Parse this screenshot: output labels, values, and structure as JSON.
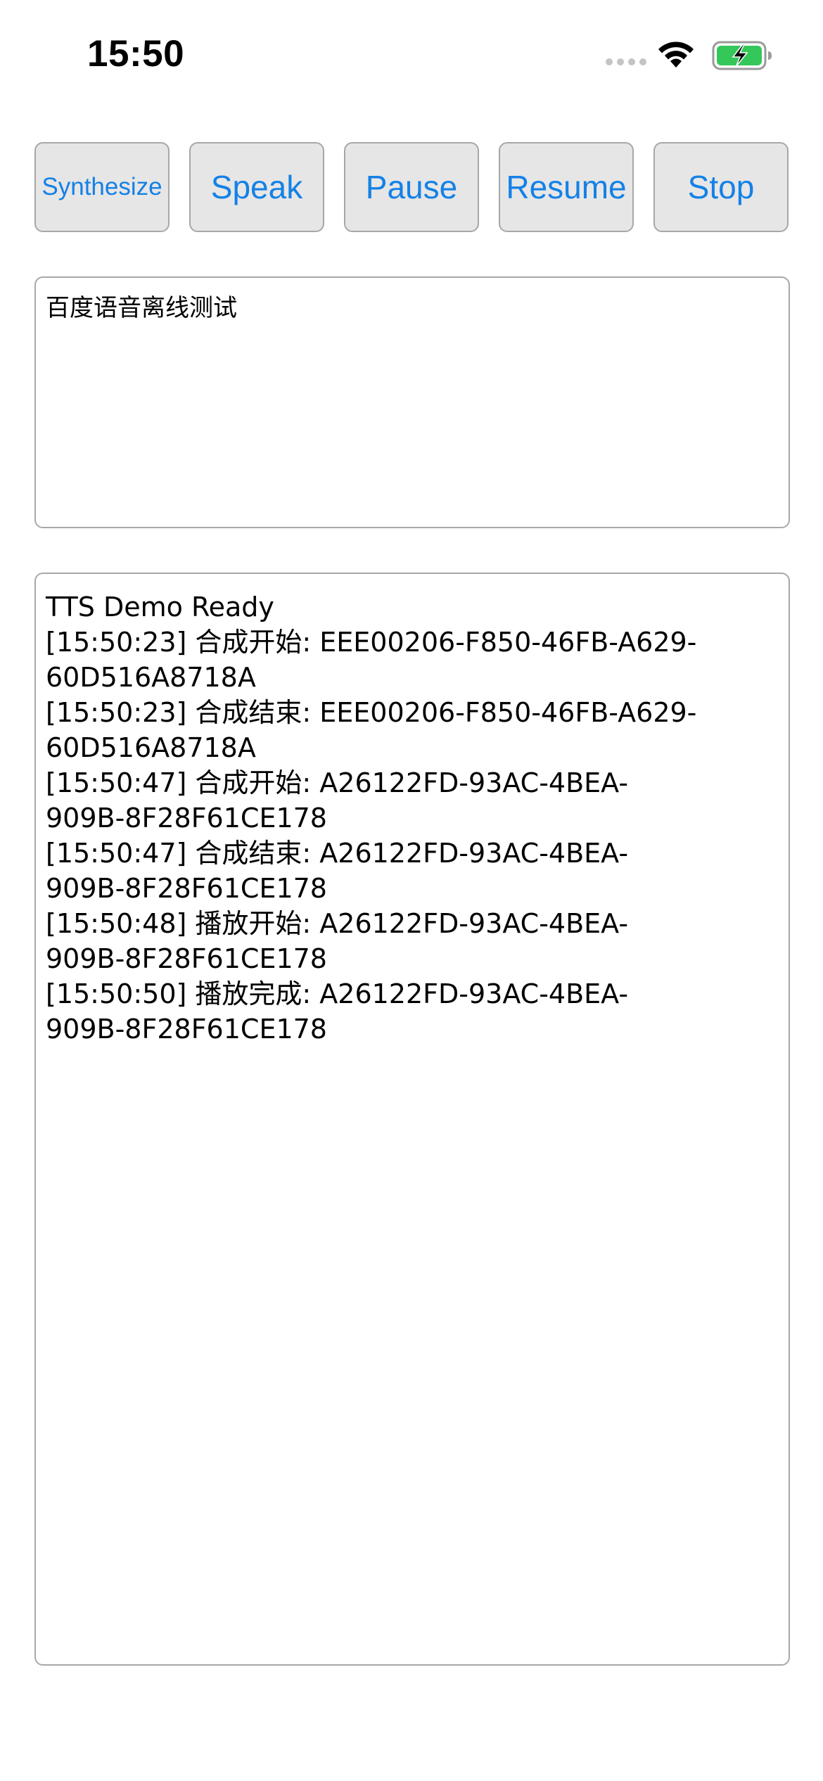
{
  "status_bar": {
    "time": "15:50",
    "icons": [
      "signal-icon",
      "wifi-icon",
      "battery-charging-icon"
    ]
  },
  "buttons": {
    "synthesize": "Synthesize",
    "speak": "Speak",
    "pause": "Pause",
    "resume": "Resume",
    "stop": "Stop"
  },
  "input": {
    "value": "百度语音离线测试"
  },
  "log": {
    "lines": [
      "TTS Demo Ready",
      "[15:50:23] 合成开始: EEE00206-F850-46FB-A629-60D516A8718A",
      "[15:50:23] 合成结束: EEE00206-F850-46FB-A629-60D516A8718A",
      "[15:50:47] 合成开始: A26122FD-93AC-4BEA-909B-8F28F61CE178",
      "[15:50:47] 合成结束: A26122FD-93AC-4BEA-909B-8F28F61CE178",
      "[15:50:48] 播放开始: A26122FD-93AC-4BEA-909B-8F28F61CE178",
      "[15:50:50] 播放完成: A26122FD-93AC-4BEA-909B-8F28F61CE178"
    ]
  },
  "colors": {
    "button_text": "#1481e6",
    "button_bg": "#e6e6e6",
    "border": "#a8a8a8",
    "battery_fill": "#34c759"
  }
}
